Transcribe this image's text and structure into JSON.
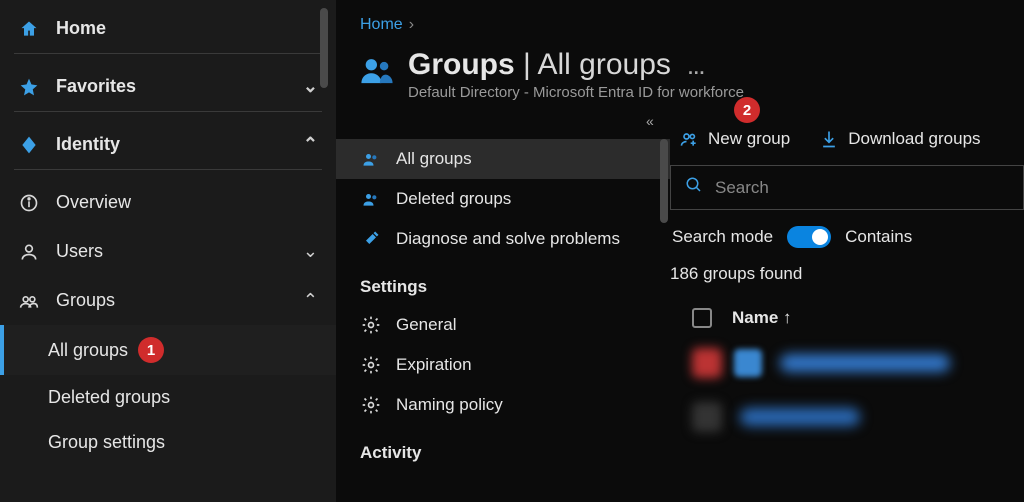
{
  "nav": {
    "home": "Home",
    "favorites": "Favorites",
    "identity": "Identity",
    "overview": "Overview",
    "users": "Users",
    "groups": "Groups",
    "all_groups": "All groups",
    "deleted_groups": "Deleted groups",
    "group_settings": "Group settings"
  },
  "badges": {
    "b1": "1",
    "b2": "2"
  },
  "breadcrumb": {
    "home": "Home"
  },
  "header": {
    "title_main": "Groups",
    "title_sub": "All groups",
    "subtitle": "Default Directory - Microsoft Entra ID for workforce",
    "more": "…"
  },
  "middle_nav": {
    "all_groups": "All groups",
    "deleted_groups": "Deleted groups",
    "diagnose": "Diagnose and solve problems",
    "settings_heading": "Settings",
    "general": "General",
    "expiration": "Expiration",
    "naming_policy": "Naming policy",
    "activity_heading": "Activity"
  },
  "toolbar": {
    "new_group": "New group",
    "download": "Download groups"
  },
  "search": {
    "placeholder": "Search",
    "mode_label": "Search mode",
    "mode_value": "Contains"
  },
  "results": {
    "count_text": "186 groups found",
    "col_name": "Name",
    "sort_arrow": "↑"
  }
}
